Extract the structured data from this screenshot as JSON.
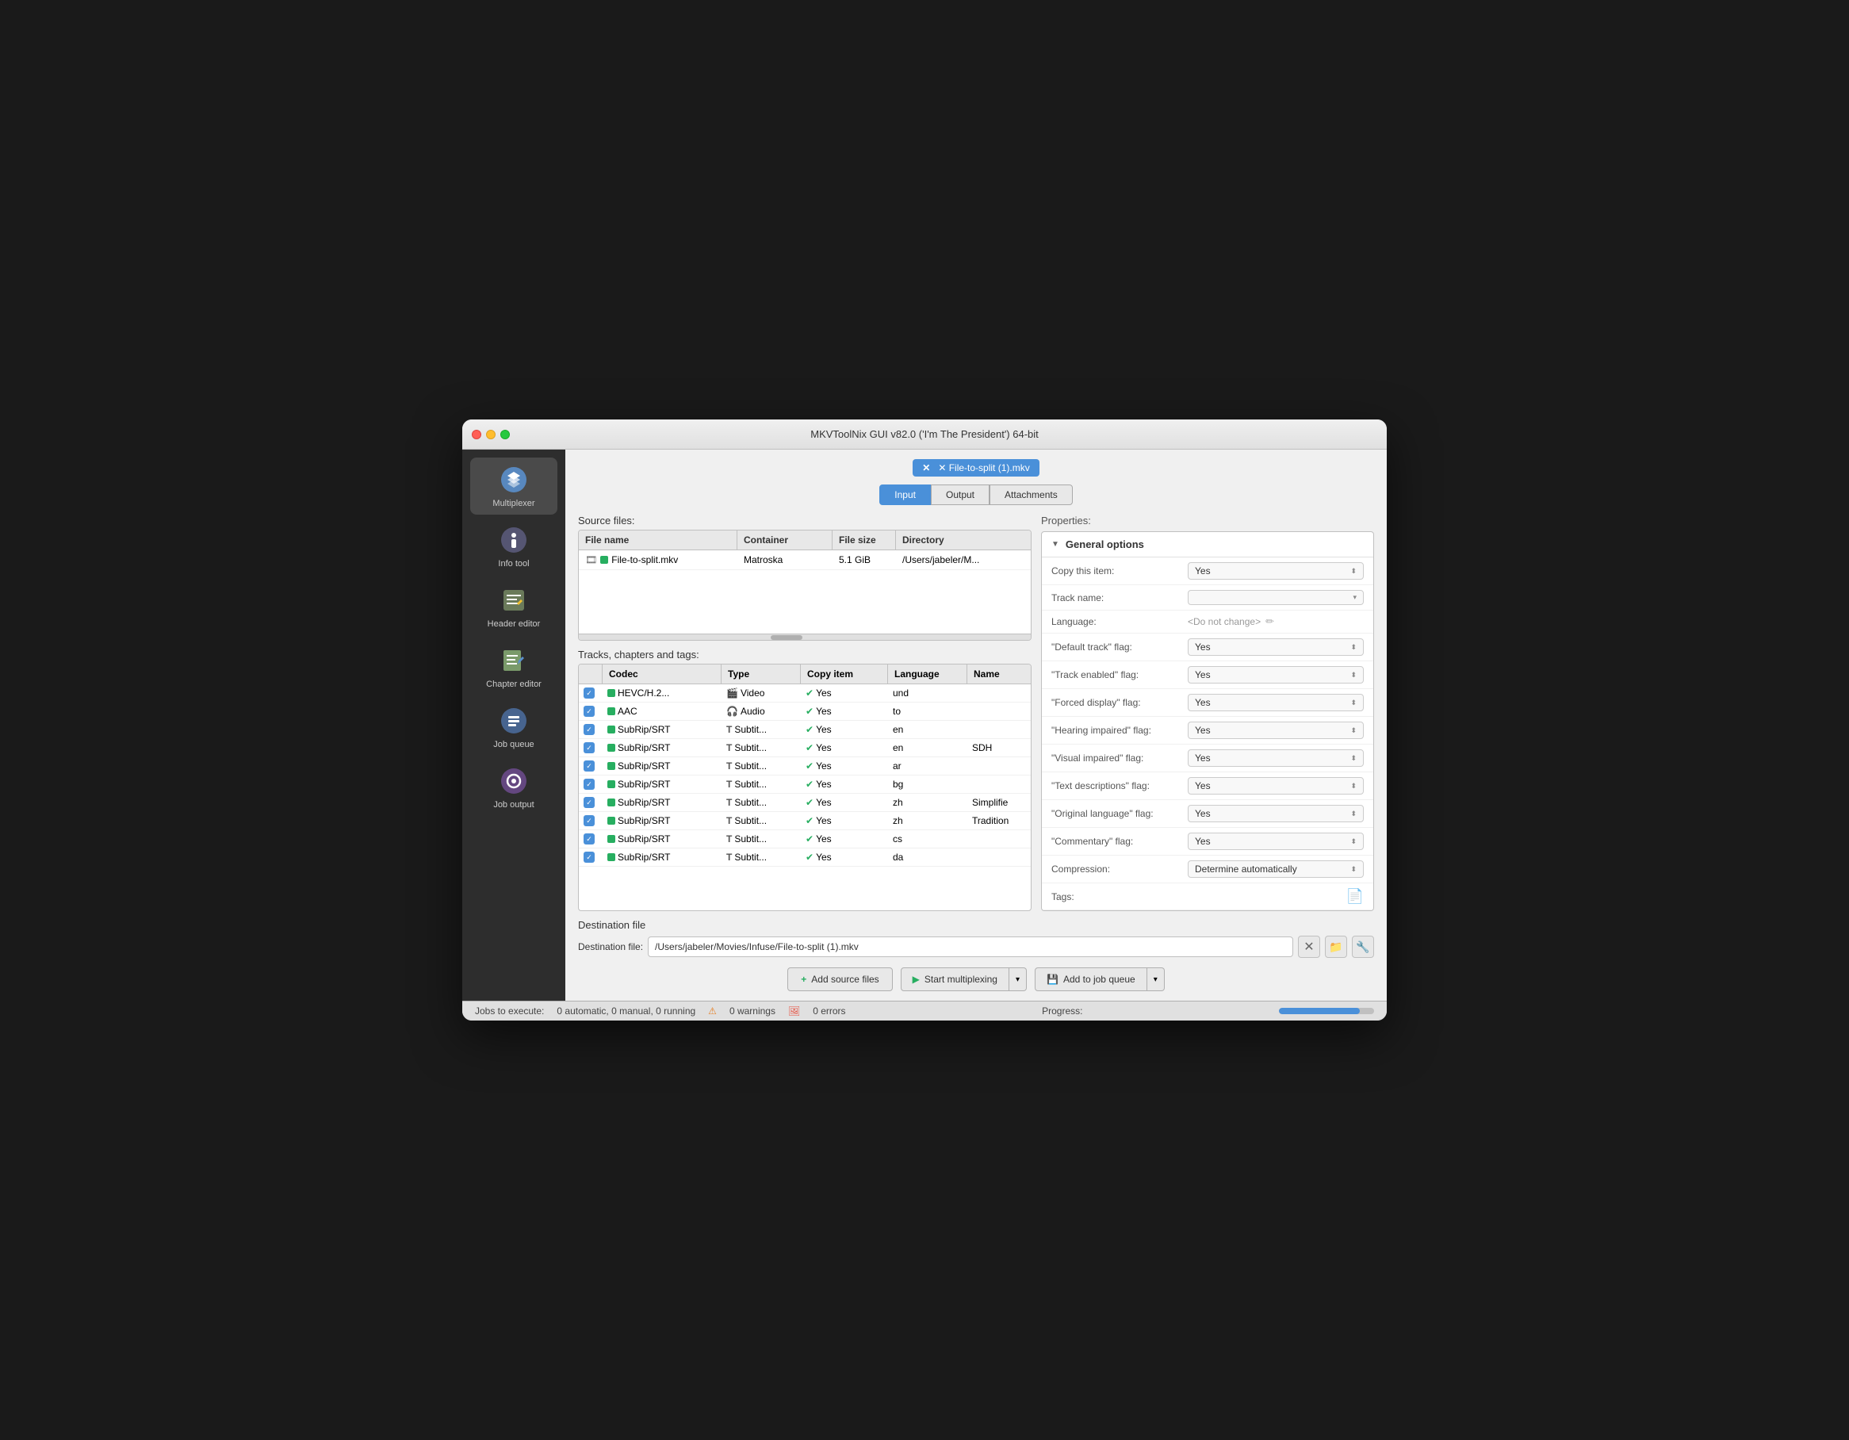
{
  "window": {
    "title": "MKVToolNix GUI v82.0 ('I'm The President') 64-bit"
  },
  "sidebar": {
    "items": [
      {
        "id": "multiplexer",
        "label": "Multiplexer",
        "active": true
      },
      {
        "id": "info-tool",
        "label": "Info tool",
        "active": false
      },
      {
        "id": "header-editor",
        "label": "Header editor",
        "active": false
      },
      {
        "id": "chapter-editor",
        "label": "Chapter editor",
        "active": false
      },
      {
        "id": "job-queue",
        "label": "Job queue",
        "active": false
      },
      {
        "id": "job-output",
        "label": "Job output",
        "active": false
      }
    ]
  },
  "file_tab": {
    "label": "✕  File-to-split (1).mkv"
  },
  "tabs": {
    "items": [
      "Input",
      "Output",
      "Attachments"
    ],
    "active": "Input"
  },
  "source_files": {
    "label": "Source files:",
    "columns": [
      "File name",
      "Container",
      "File size",
      "Directory"
    ],
    "rows": [
      {
        "file_name": "File-to-split.mkv",
        "container": "Matroska",
        "file_size": "5.1 GiB",
        "directory": "/Users/jabeler/M..."
      }
    ]
  },
  "tracks": {
    "label": "Tracks, chapters and tags:",
    "columns": [
      "",
      "Codec",
      "Type",
      "Copy item",
      "Language",
      "Name"
    ],
    "rows": [
      {
        "codec": "HEVC/H.2...",
        "type": "Video",
        "type_icon": "🎬",
        "copy": "Yes",
        "language": "und",
        "name": ""
      },
      {
        "codec": "AAC",
        "type": "Audio",
        "type_icon": "🎧",
        "copy": "Yes",
        "language": "to",
        "name": ""
      },
      {
        "codec": "SubRip/SRT",
        "type": "Subtit...",
        "type_icon": "T",
        "copy": "Yes",
        "language": "en",
        "name": ""
      },
      {
        "codec": "SubRip/SRT",
        "type": "Subtit...",
        "type_icon": "T",
        "copy": "Yes",
        "language": "en",
        "name": "SDH"
      },
      {
        "codec": "SubRip/SRT",
        "type": "Subtit...",
        "type_icon": "T",
        "copy": "Yes",
        "language": "ar",
        "name": ""
      },
      {
        "codec": "SubRip/SRT",
        "type": "Subtit...",
        "type_icon": "T",
        "copy": "Yes",
        "language": "bg",
        "name": ""
      },
      {
        "codec": "SubRip/SRT",
        "type": "Subtit...",
        "type_icon": "T",
        "copy": "Yes",
        "language": "zh",
        "name": "Simplifie"
      },
      {
        "codec": "SubRip/SRT",
        "type": "Subtit...",
        "type_icon": "T",
        "copy": "Yes",
        "language": "zh",
        "name": "Tradition"
      },
      {
        "codec": "SubRip/SRT",
        "type": "Subtit...",
        "type_icon": "T",
        "copy": "Yes",
        "language": "cs",
        "name": ""
      },
      {
        "codec": "SubRip/SRT",
        "type": "Subtit...",
        "type_icon": "T",
        "copy": "Yes",
        "language": "da",
        "name": ""
      }
    ]
  },
  "properties": {
    "label": "Properties:",
    "general_options_label": "General options",
    "fields": [
      {
        "label": "Copy this item:",
        "value": "Yes",
        "type": "select-updown"
      },
      {
        "label": "Track name:",
        "value": "",
        "type": "input-down"
      },
      {
        "label": "Language:",
        "value": "<Do not change>",
        "type": "lang-edit"
      },
      {
        "label": "\"Default track\" flag:",
        "value": "Yes",
        "type": "select-updown"
      },
      {
        "label": "\"Track enabled\" flag:",
        "value": "Yes",
        "type": "select-updown"
      },
      {
        "label": "\"Forced display\" flag:",
        "value": "Yes",
        "type": "select-updown"
      },
      {
        "label": "\"Hearing impaired\" flag:",
        "value": "Yes",
        "type": "select-updown"
      },
      {
        "label": "\"Visual impaired\" flag:",
        "value": "Yes",
        "type": "select-updown"
      },
      {
        "label": "\"Text descriptions\" flag:",
        "value": "Yes",
        "type": "select-updown"
      },
      {
        "label": "\"Original language\" flag:",
        "value": "Yes",
        "type": "select-updown"
      },
      {
        "label": "\"Commentary\" flag:",
        "value": "Yes",
        "type": "select-updown"
      },
      {
        "label": "Compression:",
        "value": "Determine automatically",
        "type": "select-updown"
      },
      {
        "label": "Tags:",
        "value": "",
        "type": "file-browse"
      }
    ]
  },
  "destination": {
    "label": "Destination file",
    "path_label": "Destination file:",
    "path": "/Users/jabeler/Movies/Infuse/File-to-split (1).mkv"
  },
  "action_buttons": {
    "add_source": "Add source files",
    "start_mux": "Start multiplexing",
    "add_job": "Add to job queue"
  },
  "status_bar": {
    "jobs_label": "Jobs to execute:",
    "jobs_count": "0 automatic, 0 manual, 0 running",
    "warnings_count": "0 warnings",
    "errors_count": "0 errors",
    "progress_label": "Progress:"
  }
}
